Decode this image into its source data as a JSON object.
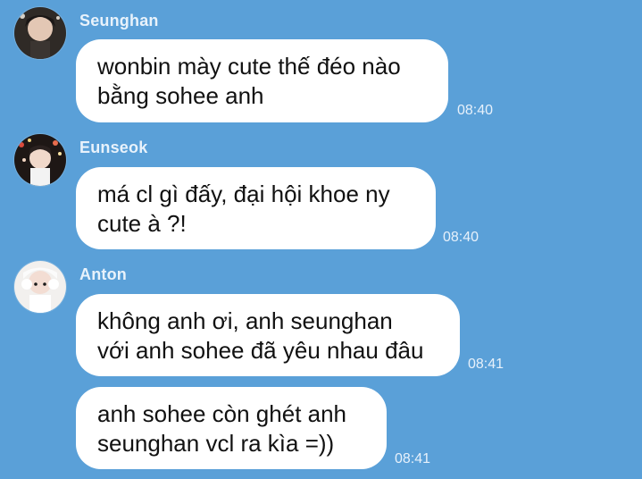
{
  "chat": {
    "background_color": "#5aa0d8",
    "messages": [
      {
        "sender": "Seunghan",
        "avatar_icon": "profile-photo-icon",
        "bubbles": [
          {
            "lines": [
              "wonbin mày cute thế đéo nào",
              "bằng sohee anh"
            ],
            "time": "08:40"
          }
        ]
      },
      {
        "sender": "Eunseok",
        "avatar_icon": "profile-photo-icon",
        "bubbles": [
          {
            "lines": [
              "má cl gì đấy, đại hội khoe ny",
              "cute à ?!"
            ],
            "time": "08:40"
          }
        ]
      },
      {
        "sender": "Anton",
        "avatar_icon": "profile-photo-icon",
        "bubbles": [
          {
            "lines": [
              "không anh ơi, anh seunghan",
              "với anh sohee đã yêu nhau đâu"
            ],
            "time": "08:41"
          },
          {
            "lines": [
              "anh sohee còn ghét anh",
              "seunghan vcl ra kìa =))"
            ],
            "time": "08:41"
          }
        ]
      }
    ]
  }
}
